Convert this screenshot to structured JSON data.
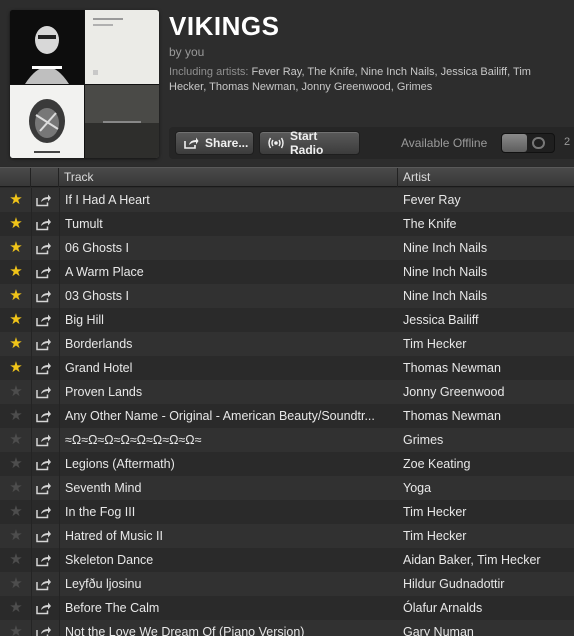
{
  "playlist": {
    "title": "VIKINGS",
    "byline": "by you",
    "including_label": "Including artists:",
    "including_artists": "Fever Ray, The Knife, Nine Inch Nails, Jessica Bailiff, Tim Hecker, Thomas Newman, Jonny Greenwood, Grimes"
  },
  "toolbar": {
    "share_label": "Share...",
    "radio_label": "Start Radio",
    "offline_label": "Available Offline",
    "offline_enabled": false,
    "offline_count": "2"
  },
  "columns": {
    "track": "Track",
    "artist": "Artist"
  },
  "colors": {
    "star_on": "#f0c419",
    "star_off": "#4d4d4d"
  },
  "tracks": [
    {
      "starred": true,
      "title": "If I Had A Heart",
      "artist": "Fever Ray"
    },
    {
      "starred": true,
      "title": "Tumult",
      "artist": "The Knife"
    },
    {
      "starred": true,
      "title": "06 Ghosts I",
      "artist": "Nine Inch Nails"
    },
    {
      "starred": true,
      "title": "A Warm Place",
      "artist": "Nine Inch Nails"
    },
    {
      "starred": true,
      "title": "03 Ghosts I",
      "artist": "Nine Inch Nails"
    },
    {
      "starred": true,
      "title": "Big Hill",
      "artist": "Jessica Bailiff"
    },
    {
      "starred": true,
      "title": "Borderlands",
      "artist": "Tim Hecker"
    },
    {
      "starred": true,
      "title": "Grand Hotel",
      "artist": "Thomas Newman"
    },
    {
      "starred": false,
      "title": "Proven Lands",
      "artist": "Jonny Greenwood"
    },
    {
      "starred": false,
      "title": "Any Other Name - Original - American Beauty/Soundtr...",
      "artist": "Thomas Newman"
    },
    {
      "starred": false,
      "title": "≈Ω≈Ω≈Ω≈Ω≈Ω≈Ω≈Ω≈Ω≈",
      "artist": "Grimes"
    },
    {
      "starred": false,
      "title": "Legions (Aftermath)",
      "artist": "Zoe Keating"
    },
    {
      "starred": false,
      "title": "Seventh Mind",
      "artist": "Yoga"
    },
    {
      "starred": false,
      "title": "In the Fog III",
      "artist": "Tim Hecker"
    },
    {
      "starred": false,
      "title": "Hatred of Music II",
      "artist": "Tim Hecker"
    },
    {
      "starred": false,
      "title": "Skeleton Dance",
      "artist": "Aidan Baker, Tim Hecker"
    },
    {
      "starred": false,
      "title": "Leyfðu ljosinu",
      "artist": "Hildur Gudnadottir"
    },
    {
      "starred": false,
      "title": "Before The Calm",
      "artist": "Ólafur Arnalds"
    },
    {
      "starred": false,
      "title": "Not the Love We Dream Of (Piano Version)",
      "artist": "Gary Numan"
    }
  ]
}
